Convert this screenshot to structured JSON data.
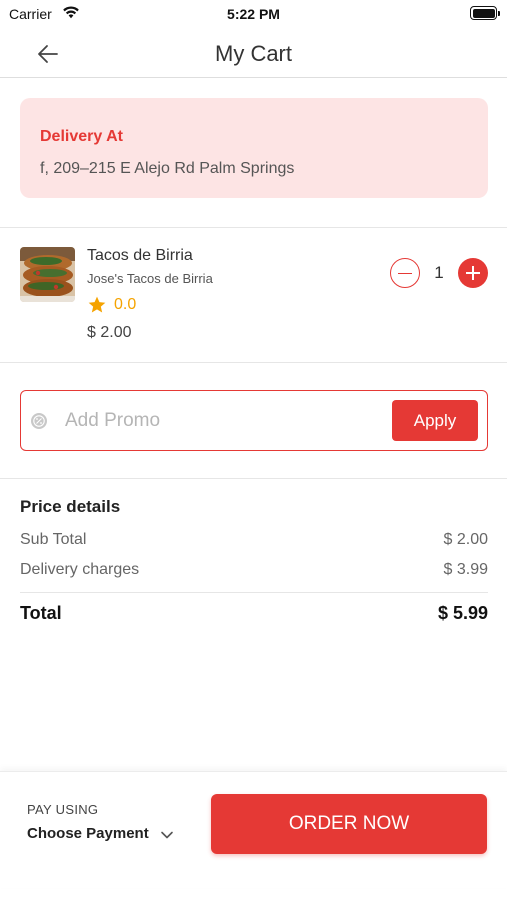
{
  "status_bar": {
    "carrier": "Carrier",
    "time": "5:22 PM"
  },
  "header": {
    "title": "My Cart",
    "back_icon": "arrow-left-icon"
  },
  "delivery": {
    "label": "Delivery At",
    "address": "f, 209–215 E Alejo Rd Palm Springs"
  },
  "cart_item": {
    "name": "Tacos de Birria",
    "restaurant": "Jose's Tacos de Birria",
    "rating": "0.0",
    "price": "$ 2.00",
    "quantity": "1"
  },
  "promo": {
    "placeholder": "Add Promo",
    "apply_label": "Apply"
  },
  "price_details": {
    "heading": "Price details",
    "subtotal_label": "Sub Total",
    "subtotal_value": "$ 2.00",
    "delivery_label": "Delivery charges",
    "delivery_value": "$ 3.99",
    "total_label": "Total",
    "total_value": "$ 5.99"
  },
  "footer": {
    "pay_using_label": "PAY USING",
    "payment_value": "Choose Payment",
    "order_button": "ORDER NOW"
  },
  "colors": {
    "accent": "#e53935",
    "delivery_bg": "#fde4e4",
    "rating": "#f5a300"
  }
}
